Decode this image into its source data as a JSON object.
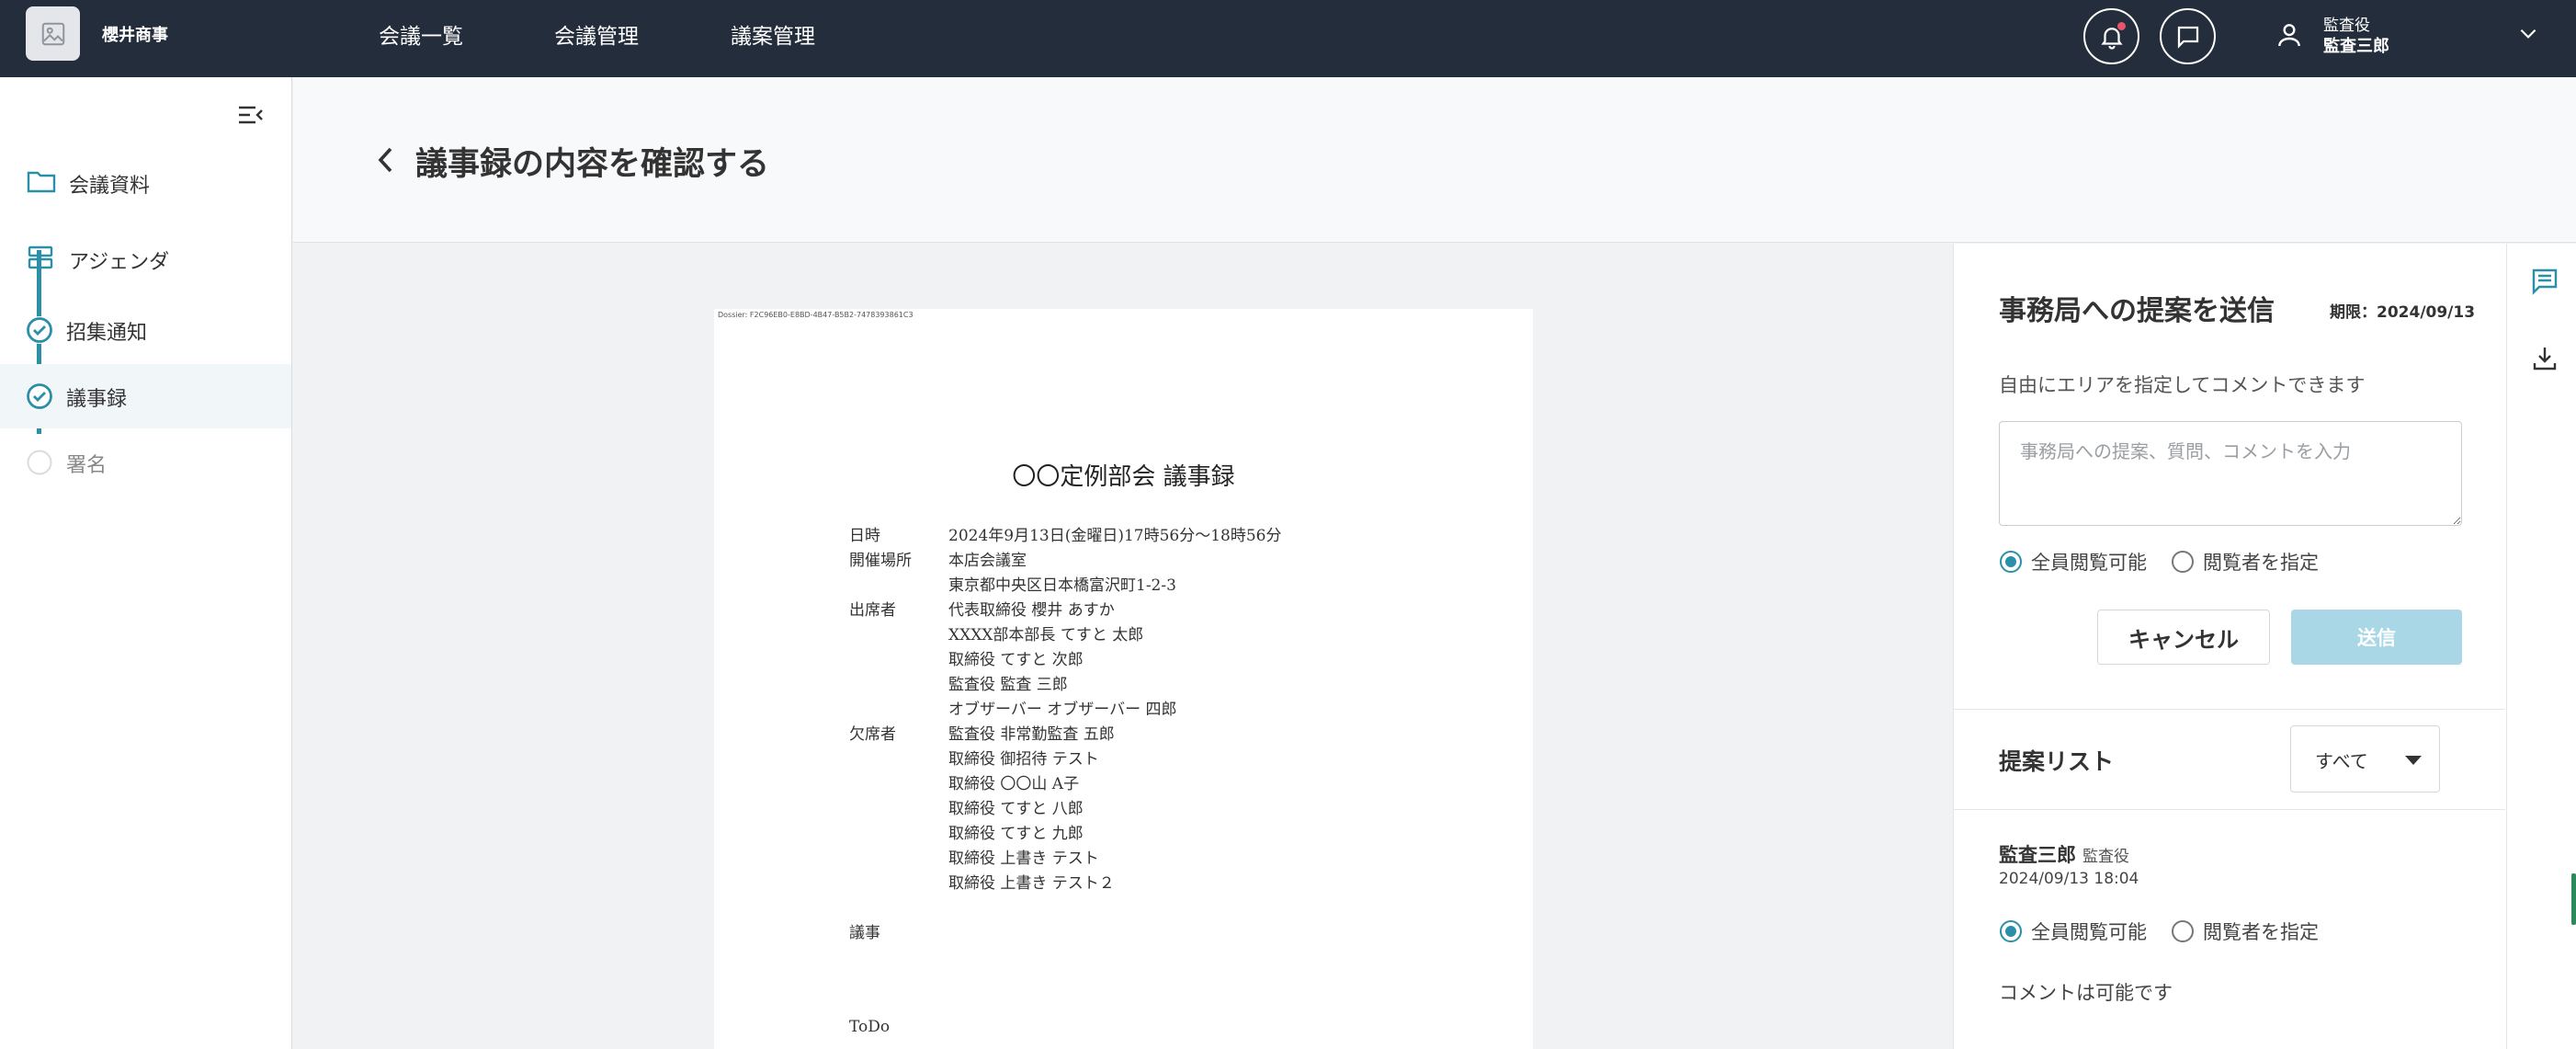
{
  "header": {
    "company": "櫻井商事",
    "nav": [
      "会議一覧",
      "会議管理",
      "議案管理"
    ],
    "user": {
      "role": "監査役",
      "name": "監査三郎"
    }
  },
  "sidebar": {
    "links": [
      {
        "label": "会議資料"
      },
      {
        "label": "アジェンダ"
      }
    ],
    "steps": [
      {
        "label": "招集通知",
        "status": "done"
      },
      {
        "label": "議事録",
        "status": "current"
      },
      {
        "label": "署名",
        "status": "pending"
      }
    ]
  },
  "page": {
    "title": "議事録の内容を確認する"
  },
  "document": {
    "dossier": "Dossier: F2C96EB0-E8BD-4B47-B5B2-7478393861C3",
    "title": "〇〇定例部会 議事録",
    "rows": [
      {
        "label": "日時",
        "value": "2024年9月13日(金曜日)17時56分〜18時56分"
      },
      {
        "label": "開催場所",
        "value": "本店会議室"
      },
      {
        "label": "",
        "value": "東京都中央区日本橋富沢町1-2-3"
      },
      {
        "label": "出席者",
        "value": "代表取締役 櫻井 あすか"
      },
      {
        "label": "",
        "value": "XXXX部本部長 てすと 太郎"
      },
      {
        "label": "",
        "value": "取締役 てすと 次郎"
      },
      {
        "label": "",
        "value": "監査役 監査 三郎"
      },
      {
        "label": "",
        "value": "オブザーバー オブザーバー 四郎"
      },
      {
        "label": "欠席者",
        "value": "監査役 非常勤監査 五郎"
      },
      {
        "label": "",
        "value": "取締役 御招待 テスト"
      },
      {
        "label": "",
        "value": "取締役 〇〇山 A子"
      },
      {
        "label": "",
        "value": "取締役 てすと 八郎"
      },
      {
        "label": "",
        "value": "取締役 てすと 九郎"
      },
      {
        "label": "",
        "value": "取締役 上書き テスト"
      },
      {
        "label": "",
        "value": "取締役 上書き テスト２"
      }
    ],
    "agenda_label": "議事",
    "todo_label": "ToDo"
  },
  "proposal": {
    "title": "事務局への提案を送信",
    "deadline": "期限：2024/09/13",
    "description": "自由にエリアを指定してコメントできます",
    "placeholder": "事務局への提案、質問、コメントを入力",
    "visibility_all": "全員閲覧可能",
    "visibility_specific": "閲覧者を指定",
    "cancel_label": "キャンセル",
    "send_label": "送信"
  },
  "list": {
    "title": "提案リスト",
    "filter": "すべて",
    "comments": [
      {
        "author": "監査三郎",
        "role": "監査役",
        "date": "2024/09/13 18:04",
        "visibility_all": "全員閲覧可能",
        "visibility_specific": "閲覧者を指定",
        "body": "コメントは可能です"
      }
    ]
  },
  "colors": {
    "header_bg": "#232d3b",
    "accent": "#2b8fa8",
    "send_disabled": "#aad7e6",
    "notification": "#e9546b"
  }
}
